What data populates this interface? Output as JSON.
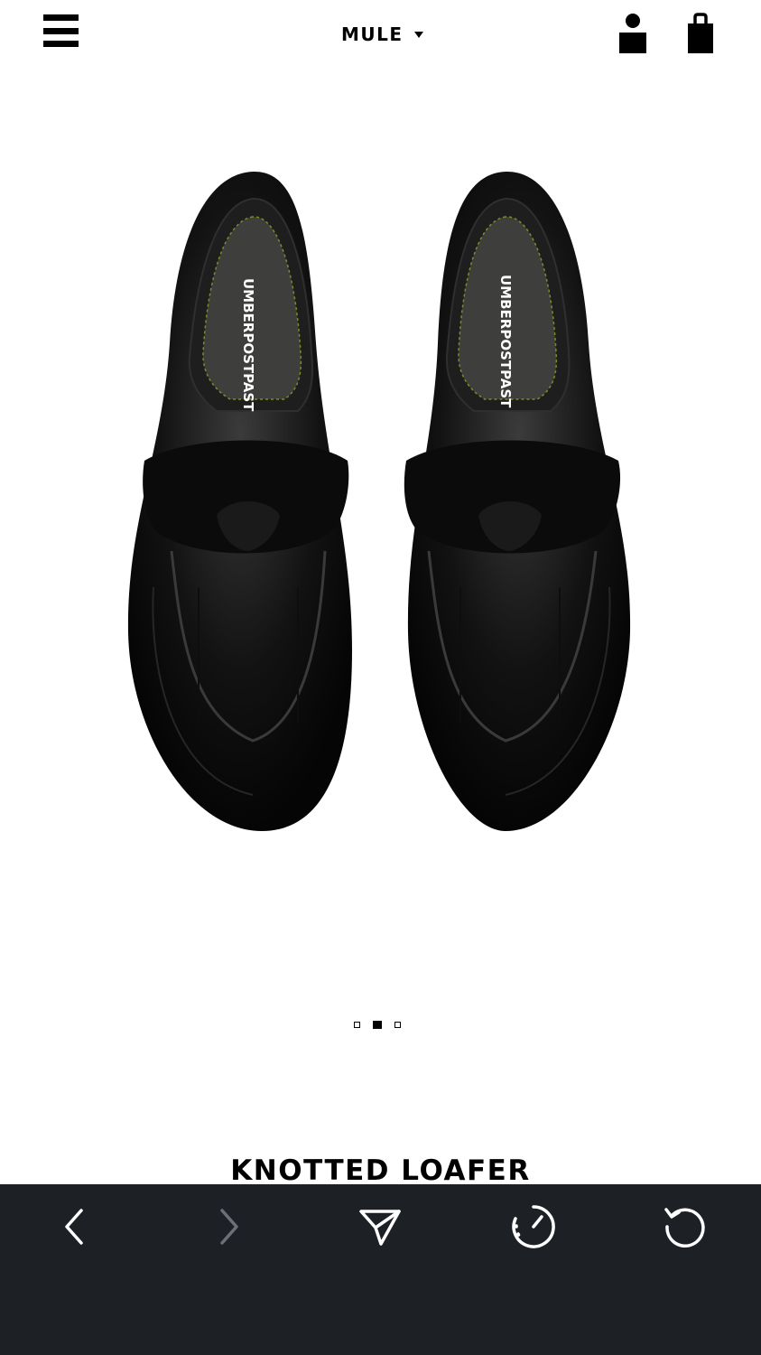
{
  "header": {
    "category_label": "MULE",
    "menu_icon": "hamburger-menu-icon",
    "account_icon": "user-icon",
    "bag_icon": "shopping-bag-icon"
  },
  "product": {
    "image_label": "UMBERPOSTPAST",
    "title": "KNOTTED LOAFER",
    "carousel": {
      "total": 3,
      "active_index": 2
    }
  },
  "browser_toolbar": {
    "background": "#1d2126",
    "icon_color": "#ffffff",
    "disabled_color": "#6b7076",
    "buttons": [
      "back-arrow-icon",
      "forward-arrow-icon",
      "send-icon",
      "timer-icon",
      "reload-icon"
    ]
  }
}
